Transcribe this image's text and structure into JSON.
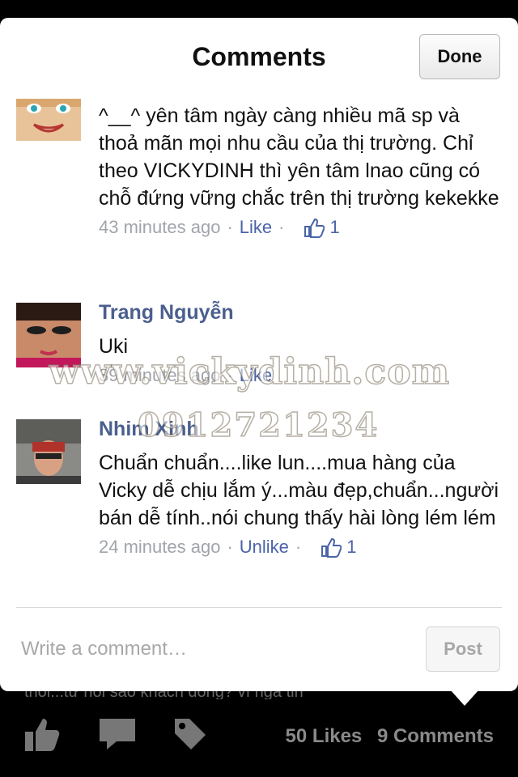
{
  "header": {
    "title": "Comments",
    "done_label": "Done"
  },
  "comments": [
    {
      "author": "",
      "text": "^__^ yên tâm ngày càng nhiều mã sp và thoả mãn mọi nhu cầu của thị trường. Chỉ theo VICKYDINH thì yên tâm lnao cũng có chỗ đứng vững chắc trên thị trường kekekke",
      "time": "43 minutes ago",
      "action": "Like",
      "like_count": "1"
    },
    {
      "author": "Trang Nguyễn",
      "text": "Uki",
      "time": "39 minutes ago",
      "action": "Like",
      "like_count": ""
    },
    {
      "author": "Nhim Xinh",
      "text": "Chuẩn chuẩn....like lun....mua hàng của Vicky dễ chịu lắm ý...màu đẹp,chuẩn...người bán dễ tính..nói chung thấy hài lòng lém lém",
      "time": "24 minutes ago",
      "action": "Unlike",
      "like_count": "1"
    }
  ],
  "composer": {
    "placeholder": "Write a comment…",
    "post_label": "Post"
  },
  "background_text": "thoi...từ hồi sao khách đông? vì ngã tin",
  "footer": {
    "likes": "50 Likes",
    "comments": "9 Comments"
  },
  "watermark": {
    "site": "www.vickydinh.com",
    "phone": "0912721234"
  },
  "colors": {
    "link": "#4a64a8",
    "author": "#4b5f8e",
    "meta": "#a0a4ab"
  }
}
